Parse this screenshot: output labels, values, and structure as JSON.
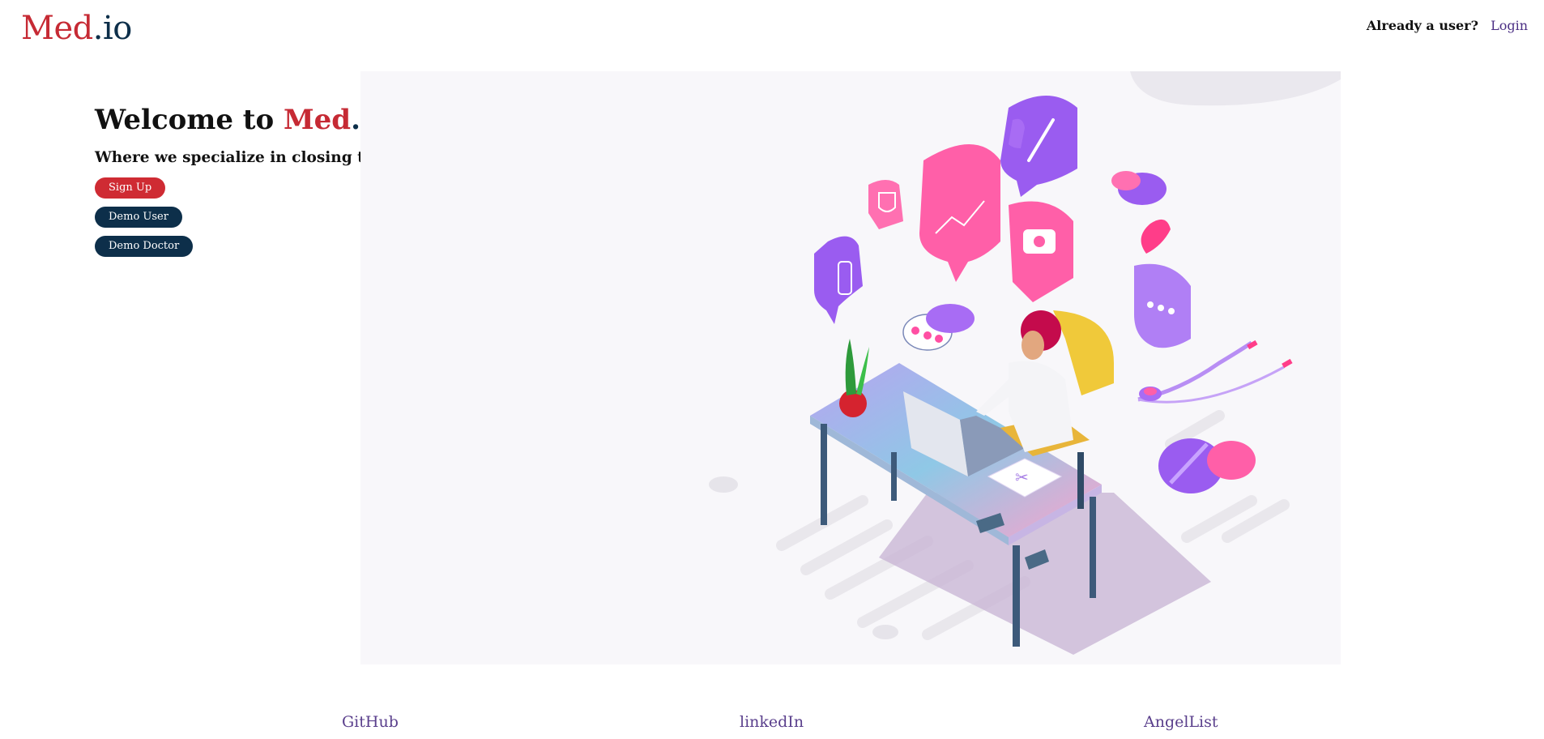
{
  "header": {
    "logo_primary": "Med",
    "logo_secondary": ".io",
    "already_user": "Already a user?",
    "login_label": "Login"
  },
  "hero": {
    "title_prefix": "Welcome to ",
    "title_brand_primary": "Med",
    "title_brand_secondary": ".io",
    "title_suffix": "!",
    "subtitle": "Where we specialize in closing the communication gap between doctors and patients.",
    "signup_label": "Sign Up",
    "demo_user_label": "Demo User",
    "demo_doctor_label": "Demo Doctor"
  },
  "illustration": {
    "description_icon": "doctor-desk-illustration",
    "colors": {
      "pink": "#ff5fa8",
      "purple": "#9a5cf0",
      "navy": "#0d2f4a",
      "red": "#c62a34"
    }
  },
  "footer": {
    "github": "GitHub",
    "linkedin": "linkedIn",
    "angellist": "AngelList"
  }
}
